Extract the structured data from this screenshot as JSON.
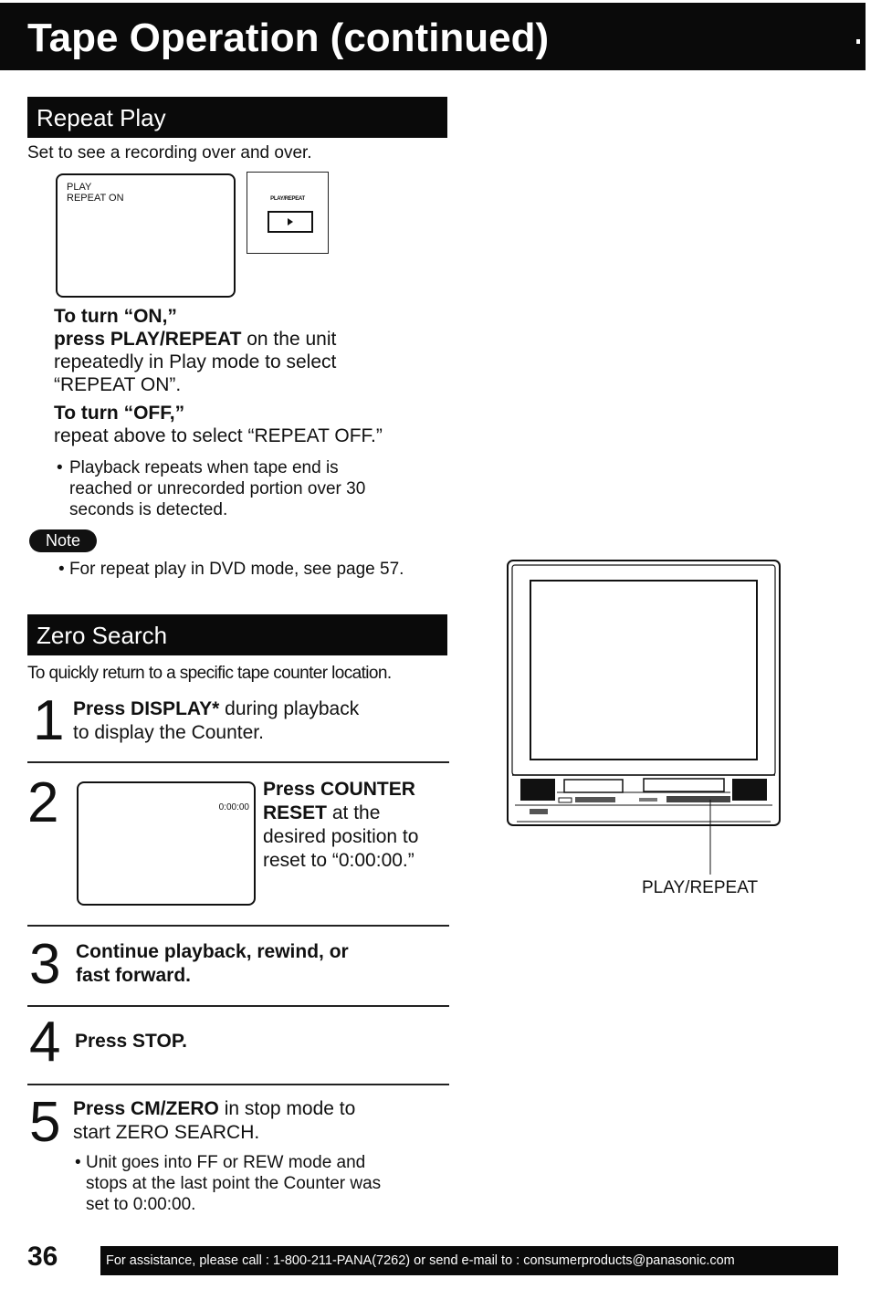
{
  "header": {
    "title": "Tape Operation (continued)"
  },
  "repeat_play": {
    "heading": "Repeat Play",
    "intro": "Set to see a recording over and over.",
    "osd_lines": [
      "PLAY",
      "REPEAT ON"
    ],
    "button_label": "PLAY/REPEAT",
    "button_icon": "play-triangle-icon",
    "on_heading": "To turn “ON,”",
    "on_bold": "press PLAY/REPEAT",
    "on_text_1": " on the unit",
    "on_text_2": "repeatedly in Play mode to select",
    "on_text_3": "“REPEAT ON”.",
    "off_heading": "To turn “OFF,”",
    "off_text": "repeat above to select “REPEAT OFF.”",
    "bullet_lines": [
      "Playback repeats when tape end is",
      "reached or unrecorded portion over 30",
      "seconds is detected."
    ],
    "note_label": "Note",
    "note_text": "For repeat play in DVD mode, see page 57."
  },
  "zero_search": {
    "heading": "Zero Search",
    "intro": "To quickly return to a specific tape counter location.",
    "steps": [
      {
        "num": "1",
        "bold": "Press DISPLAY*",
        "text_1": " during playback",
        "text_2": "to display the Counter."
      },
      {
        "num": "2",
        "bold_1": "Press COUNTER",
        "bold_2": "RESET",
        "text_1": " at the",
        "text_2": "desired position to",
        "text_3": "reset to “0:00:00.”",
        "osd_counter": "0:00:00"
      },
      {
        "num": "3",
        "bold_1": "Continue playback, rewind, or",
        "bold_2": "fast forward."
      },
      {
        "num": "4",
        "bold": "Press STOP."
      },
      {
        "num": "5",
        "bold": "Press CM/ZERO",
        "text_1": " in stop mode to",
        "text_2": "start ZERO SEARCH.",
        "bullet_lines": [
          "Unit goes into FF or REW mode and",
          "stops at the last point the Counter was",
          "set to 0:00:00."
        ]
      }
    ]
  },
  "illustration": {
    "callout_label": "PLAY/REPEAT"
  },
  "footer": {
    "page_number": "36",
    "assistance": "For assistance, please call : 1-800-211-PANA(7262) or send e-mail to : consumerproducts@panasonic.com"
  }
}
